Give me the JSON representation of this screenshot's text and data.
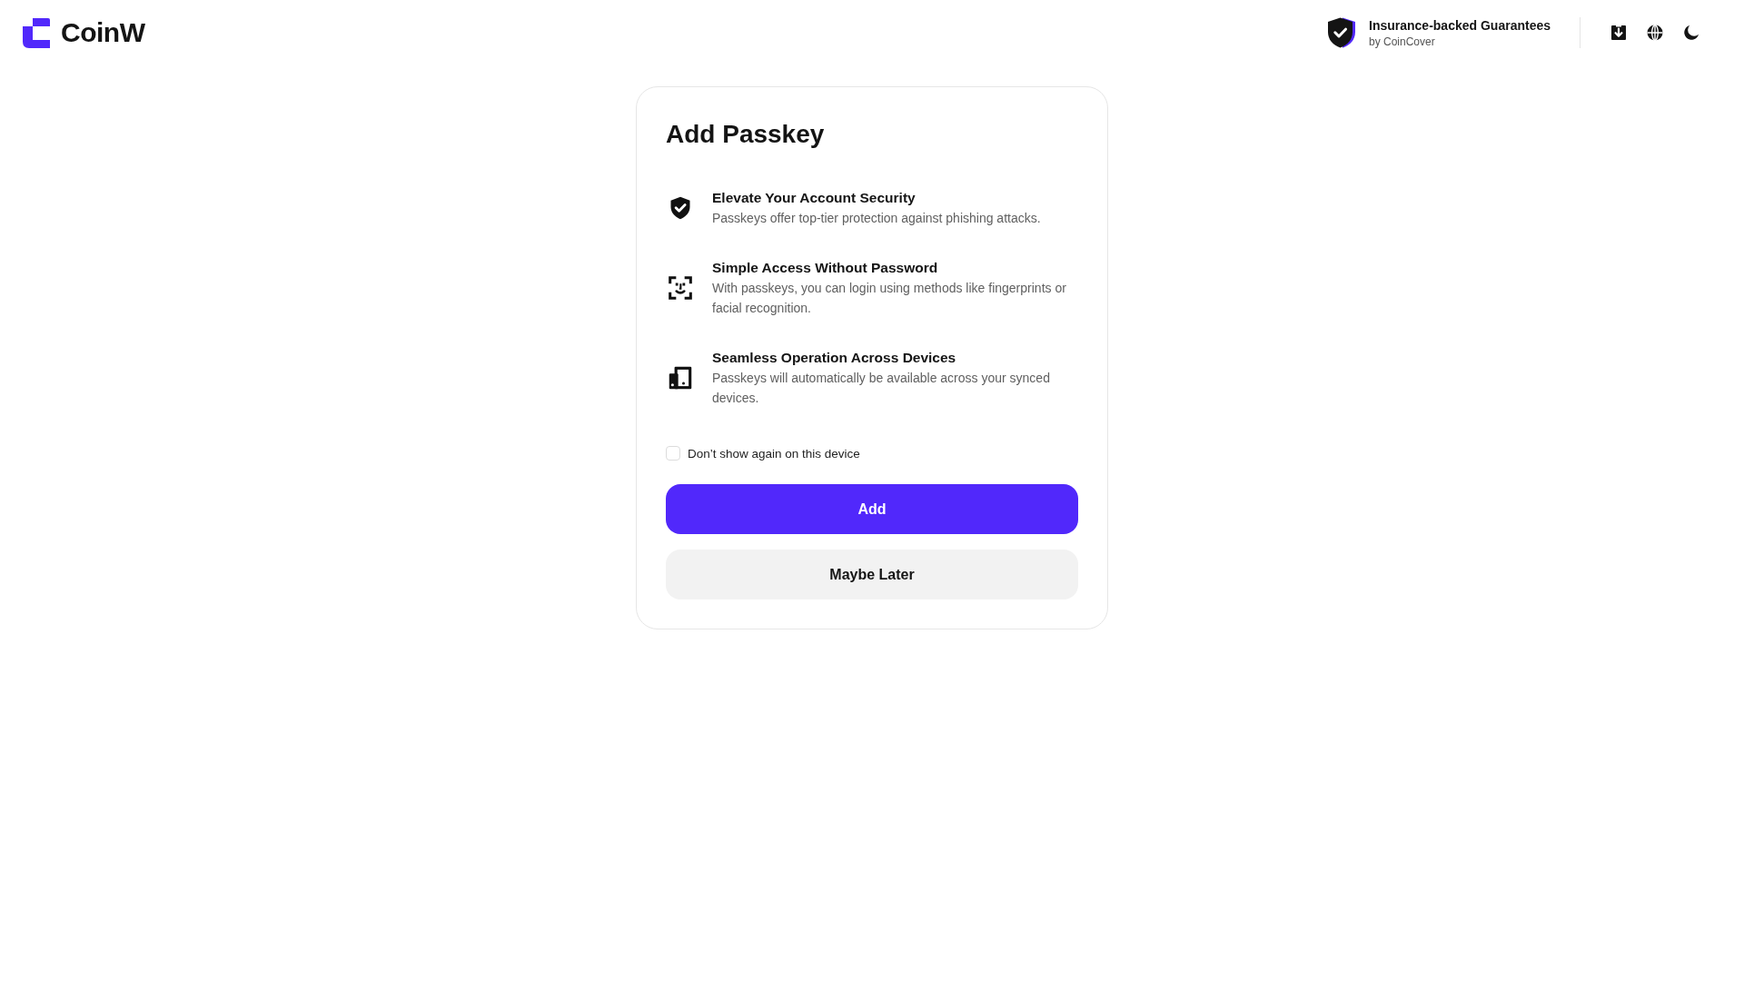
{
  "header": {
    "logo": "CoinW",
    "insurance": {
      "title": "Insurance-backed Guarantees",
      "subtitle": "by CoinCover"
    }
  },
  "dialog": {
    "title": "Add Passkey",
    "features": [
      {
        "title": "Elevate Your Account Security",
        "description": "Passkeys offer top-tier protection against phishing attacks."
      },
      {
        "title": "Simple Access Without Password",
        "description": "With passkeys, you can login using methods like fingerprints or facial recognition."
      },
      {
        "title": "Seamless Operation Across Devices",
        "description": "Passkeys will automatically be available across your synced devices."
      }
    ],
    "dont_show_again": {
      "label": "Don’t show again on this device",
      "checked": false
    },
    "buttons": [
      {
        "label": "Add",
        "kind": "primary"
      },
      {
        "label": "Maybe Later",
        "kind": "secondary"
      }
    ]
  }
}
